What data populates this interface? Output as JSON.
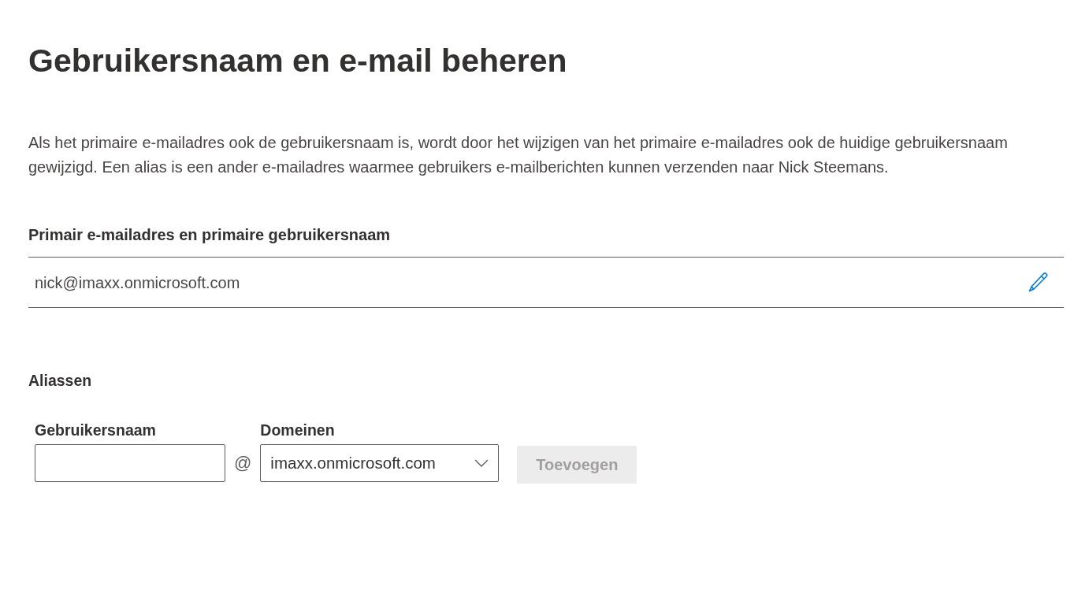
{
  "page": {
    "title": "Gebruikersnaam en e-mail beheren",
    "description": "Als het primaire e-mailadres ook de gebruikersnaam is, wordt door het wijzigen van het primaire e-mailadres ook de huidige gebruikersnaam gewijzigd. Een alias is een ander e-mailadres waarmee gebruikers e-mailberichten kunnen verzenden naar Nick Steemans."
  },
  "primary": {
    "heading": "Primair e-mailadres en primaire gebruikersnaam",
    "value": "nick@imaxx.onmicrosoft.com"
  },
  "aliases": {
    "heading": "Aliassen",
    "username_field": {
      "label": "Gebruikersnaam"
    },
    "separator": "@",
    "domain_field": {
      "label": "Domeinen",
      "value": "imaxx.onmicrosoft.com"
    },
    "add_button": {
      "label": "Toevoegen",
      "disabled": true
    }
  }
}
